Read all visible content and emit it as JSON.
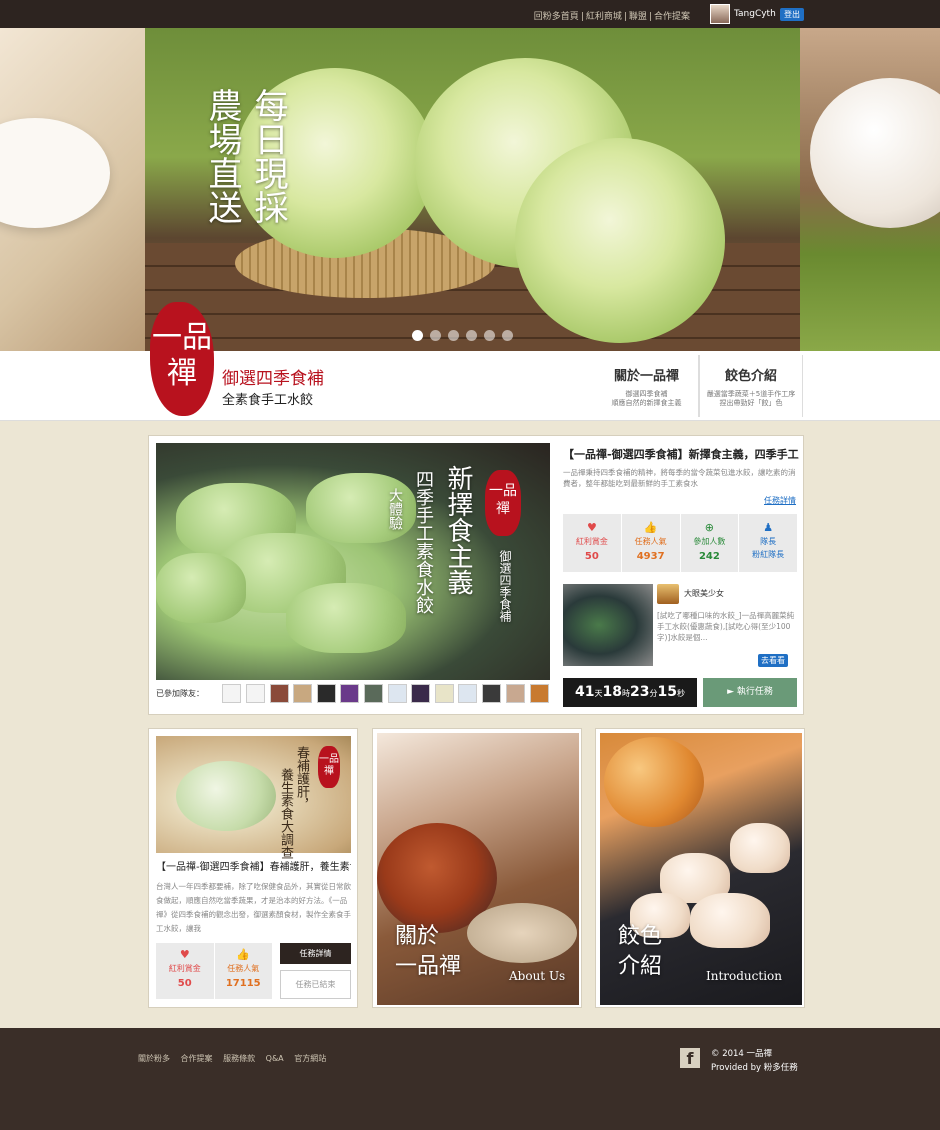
{
  "topbar": {
    "links": [
      "回粉多首頁",
      "紅利商城",
      "聯盟",
      "合作提案"
    ],
    "username": "TangCyth",
    "logout_label": "登出"
  },
  "hero": {
    "title_line1": "每日現採",
    "title_line2": "農場直送",
    "slide_count": 6,
    "active_slide": 1
  },
  "brand": {
    "seal_text": "一品禪",
    "name": "御選四季食補",
    "subtitle": "全素食手工水餃",
    "nav": [
      {
        "title": "關於一品禪",
        "sub1": "御選四季食補",
        "sub2": "順應自然的新擇食主義"
      },
      {
        "title": "餃色介紹",
        "sub1": "嚴選當季蔬菜＋5道手作工序",
        "sub2": "捏出帶勁好「餃」色"
      }
    ]
  },
  "main_mission": {
    "image_text": {
      "big": "新擇食主義",
      "mid": "四季手工素食水餃",
      "small": "大體驗",
      "side": "御選四季食補",
      "seal": "一品禪"
    },
    "title": "【一品禪-御選四季食補】新擇食主義，四季手工素食水餃大體驗",
    "description": "一品禪秉持四季食補的精神，將每季的當令蔬菜包進水餃，讓吃素的消費者，整年都能吃到最新鮮的手工素食水",
    "detail_link": "任務詳情",
    "members_label": "已參加隊友：",
    "stats": [
      {
        "icon": "♥",
        "label": "紅利賞金",
        "value": "50"
      },
      {
        "icon": "👍",
        "label": "任務人氣",
        "value": "4937"
      },
      {
        "icon": "⊕",
        "label": "參加人數",
        "value": "242"
      },
      {
        "icon": "♟",
        "label": "隊長",
        "value": "粉紅隊長"
      }
    ],
    "post": {
      "author": "大眼美少女",
      "text": "[試吃了哪種口味的水餃_]一品禪高麗菜純手工水餃(優惠蔬食),[試吃心得(至少100字)]水餃是個...",
      "button": "去看看"
    },
    "countdown": {
      "days": "41",
      "days_unit": "天",
      "hours": "18",
      "hours_unit": "時",
      "minutes": "23",
      "minutes_unit": "分",
      "seconds": "15",
      "seconds_unit": "秒"
    },
    "execute_label": "► 執行任務"
  },
  "small_mission": {
    "image_text": {
      "line1": "春補護肝，",
      "line2": "養生素食大調查",
      "seal": "一品禪"
    },
    "title": "【一品禪-御選四季食補】春補護肝，養生素食大調查",
    "description": "台灣人一年四季都要補，除了吃保健食品外，其實從日常飲食做起，順應自然吃當季蔬果，才是治本的好方法。《一品禪》從四季食補的觀念出發，御選素顏食材，製作全素食手工水餃，讓我",
    "stats": [
      {
        "icon": "♥",
        "label": "紅利賞金",
        "value": "50"
      },
      {
        "icon": "👍",
        "label": "任務人氣",
        "value": "17115"
      }
    ],
    "detail_button": "任務詳情",
    "ended_button": "任務已結束"
  },
  "about_card": {
    "title_line1": "關於",
    "title_line2": "一品禪",
    "subtitle": "About Us"
  },
  "intro_card": {
    "title_line1": "餃色",
    "title_line2": "介紹",
    "subtitle": "Introduction"
  },
  "footer": {
    "links": [
      "關於粉多",
      "合作提案",
      "服務條款",
      "Q&A",
      "官方網站"
    ],
    "fb_icon": "f",
    "copyright": "© 2014 一品禪",
    "provided": "Provided by 粉多任務"
  }
}
